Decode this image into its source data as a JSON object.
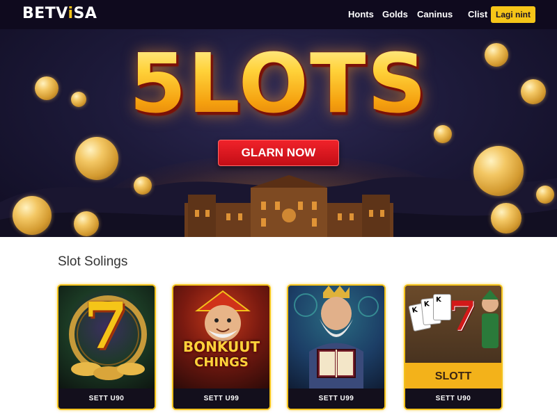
{
  "nav": {
    "logo_main": "BETV",
    "logo_accent": "i",
    "logo_tail": "SA",
    "links": [
      "Honts",
      "Golds",
      "Caninus",
      "Clist"
    ],
    "login_label": "Lagi nint"
  },
  "hero": {
    "title": "5LOTS",
    "cta_label": "GLARN NOW"
  },
  "section": {
    "title": "Slot Solings"
  },
  "cards": [
    {
      "art_text": "7",
      "label": "SETT U90"
    },
    {
      "art_text_1": "BONKUUT",
      "art_text_2": "CHINGS",
      "label": "SETT U99"
    },
    {
      "label": "SETT U99"
    },
    {
      "art_text": "SLOTT",
      "label": "SETT U90",
      "card_ranks": [
        "K",
        "K",
        "K"
      ]
    }
  ],
  "colors": {
    "nav_bg": "#0f0a1e",
    "accent_gold": "#f5c518",
    "cta_red": "#d8141c"
  }
}
